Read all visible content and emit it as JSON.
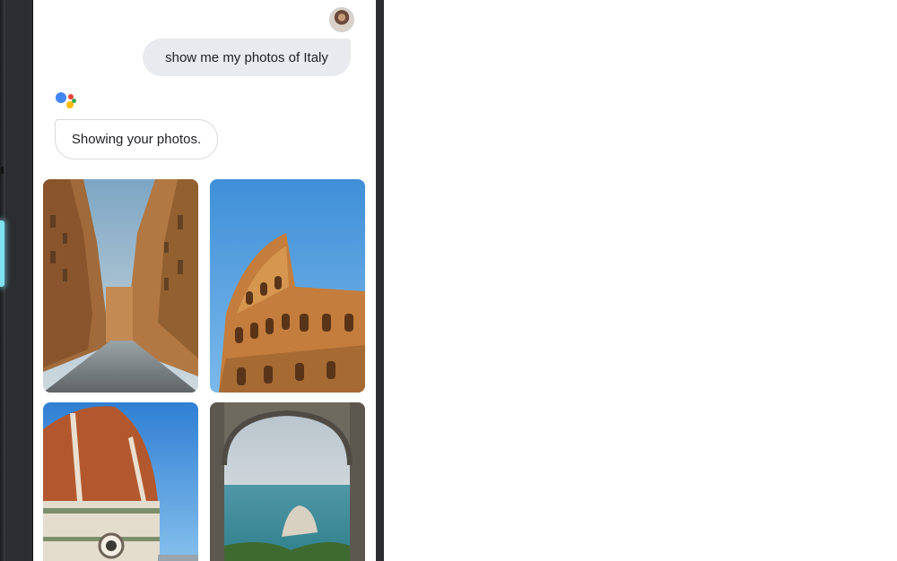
{
  "conversation": {
    "user_message": "show me my photos of Italy",
    "assistant_message": "Showing your photos."
  },
  "photos": [
    {
      "subject": "narrow-street"
    },
    {
      "subject": "colosseum"
    },
    {
      "subject": "cathedral-dome"
    },
    {
      "subject": "sea-arch"
    }
  ],
  "colors": {
    "user_bubble": "#e8eaed",
    "assistant_border": "#d7d9dc",
    "glow_button": "#7fe0ee",
    "phone_frame": "#2b2d30"
  }
}
